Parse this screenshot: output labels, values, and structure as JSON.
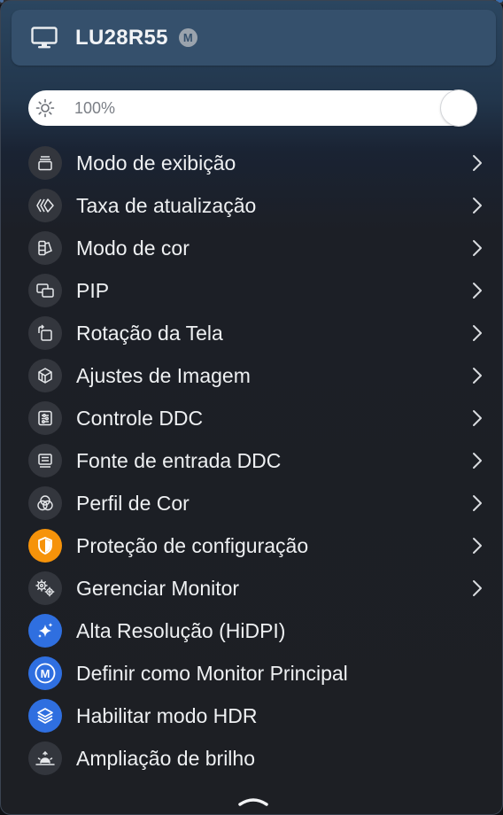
{
  "header": {
    "title": "LU28R55",
    "badge": "M",
    "icon": "monitor-icon"
  },
  "brightness": {
    "value_label": "100%",
    "value": 1.0,
    "icon": "sun-icon"
  },
  "menu": {
    "items": [
      {
        "label": "Modo de exibição",
        "icon": "display-mode-icon",
        "submenu": true
      },
      {
        "label": "Taxa de atualização",
        "icon": "refresh-rate-icon",
        "submenu": true
      },
      {
        "label": "Modo de cor",
        "icon": "color-mode-icon",
        "submenu": true
      },
      {
        "label": "PIP",
        "icon": "pip-icon",
        "submenu": true
      },
      {
        "label": "Rotação da Tela",
        "icon": "rotate-icon",
        "submenu": true
      },
      {
        "label": "Ajustes de Imagem",
        "icon": "image-adjust-icon",
        "submenu": true
      },
      {
        "label": "Controle DDC",
        "icon": "ddc-control-icon",
        "submenu": true
      },
      {
        "label": "Fonte de entrada DDC",
        "icon": "input-source-icon",
        "submenu": true
      },
      {
        "label": "Perfil de Cor",
        "icon": "color-profile-icon",
        "submenu": true
      },
      {
        "label": "Proteção de configuração",
        "icon": "shield-icon",
        "submenu": true
      },
      {
        "label": "Gerenciar Monitor",
        "icon": "gears-icon",
        "submenu": true
      },
      {
        "label": "Alta Resolução (HiDPI)",
        "icon": "sparkle-icon",
        "submenu": false
      },
      {
        "label": "Definir como Monitor Principal",
        "icon": "main-monitor-icon",
        "submenu": false
      },
      {
        "label": "Habilitar modo HDR",
        "icon": "layers-icon",
        "submenu": false
      },
      {
        "label": "Ampliação de brilho",
        "icon": "sunrise-icon",
        "submenu": false
      }
    ]
  },
  "footer": {
    "icon": "chevron-up-icon"
  },
  "colors": {
    "accent_orange": "#f6930a",
    "accent_blue": "#2f6fe0",
    "header_bg": "#35506c"
  }
}
